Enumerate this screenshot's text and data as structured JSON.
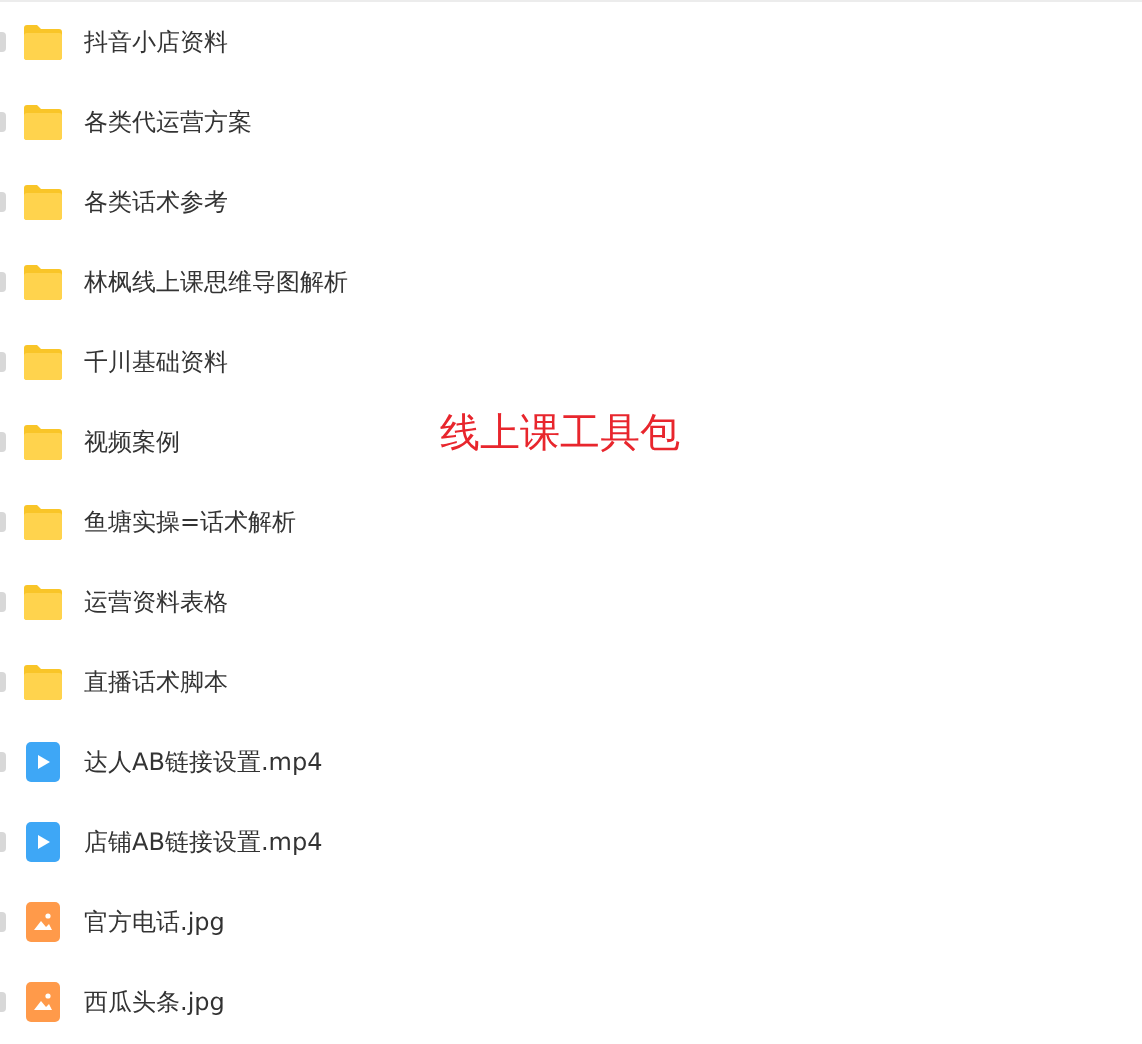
{
  "files": [
    {
      "name": "抖音小店资料",
      "kind": "folder",
      "checked": false
    },
    {
      "name": "各类代运营方案",
      "kind": "folder",
      "checked": false
    },
    {
      "name": "各类话术参考",
      "kind": "folder",
      "checked": false
    },
    {
      "name": "林枫线上课思维导图解析",
      "kind": "folder",
      "checked": false
    },
    {
      "name": "千川基础资料",
      "kind": "folder",
      "checked": false
    },
    {
      "name": "视频案例",
      "kind": "folder",
      "checked": false
    },
    {
      "name": "鱼塘实操=话术解析",
      "kind": "folder",
      "checked": false
    },
    {
      "name": "运营资料表格",
      "kind": "folder",
      "checked": false
    },
    {
      "name": "直播话术脚本",
      "kind": "folder",
      "checked": false
    },
    {
      "name": "达人AB链接设置.mp4",
      "kind": "video",
      "checked": false
    },
    {
      "name": "店铺AB链接设置.mp4",
      "kind": "video",
      "checked": false
    },
    {
      "name": "官方电话.jpg",
      "kind": "image",
      "checked": false
    },
    {
      "name": "西瓜头条.jpg",
      "kind": "image",
      "checked": false
    }
  ],
  "overlay_title": "线上课工具包"
}
